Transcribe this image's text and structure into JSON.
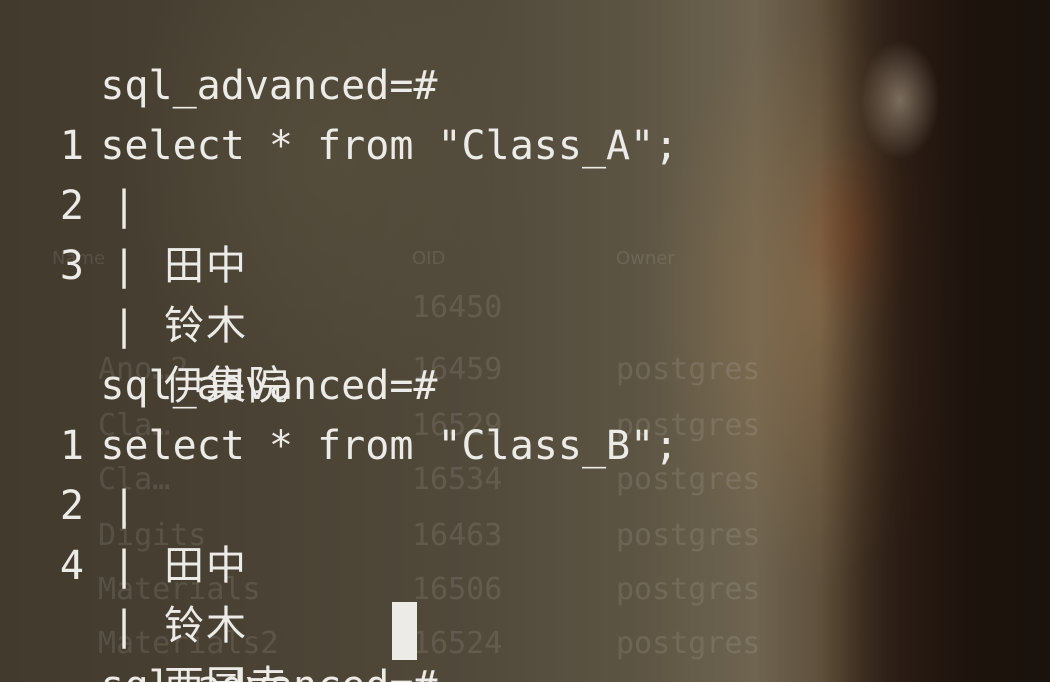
{
  "prompt": "sql_advanced=#",
  "query_a": {
    "command": "select * from \"Class_A\";",
    "rows": [
      {
        "id": "1",
        "name": "田中"
      },
      {
        "id": "2",
        "name": "铃木"
      },
      {
        "id": "3",
        "name": "伊集院"
      }
    ]
  },
  "query_b": {
    "command": "select * from \"Class_B\";",
    "rows": [
      {
        "id": "1",
        "name": "田中"
      },
      {
        "id": "2",
        "name": "铃木"
      },
      {
        "id": "4",
        "name": "西园寺"
      }
    ]
  },
  "separator": "|",
  "background_window": {
    "headers": [
      "Name",
      "OID",
      "Owner"
    ],
    "rows": [
      {
        "name": "",
        "oid": "16450",
        "owner": ""
      },
      {
        "name": "Ano…2",
        "oid": "16459",
        "owner": "postgres"
      },
      {
        "name": "Cla…",
        "oid": "16529",
        "owner": "postgres"
      },
      {
        "name": "Cla…",
        "oid": "16534",
        "owner": "postgres"
      },
      {
        "name": "Digits",
        "oid": "16463",
        "owner": "postgres"
      },
      {
        "name": "Materials",
        "oid": "16506",
        "owner": "postgres"
      },
      {
        "name": "Materials2",
        "oid": "16524",
        "owner": "postgres"
      }
    ]
  },
  "colors": {
    "text": "#ecebe7",
    "cursor": "#ecebe7"
  }
}
